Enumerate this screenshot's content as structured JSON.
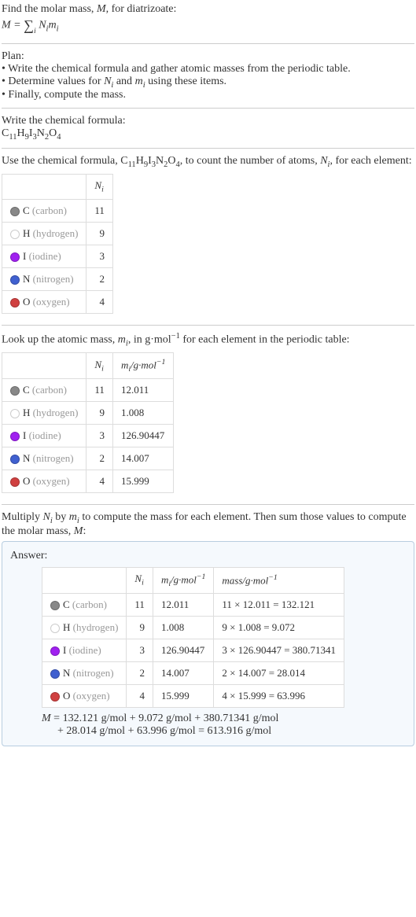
{
  "intro": {
    "line1_a": "Find the molar mass, ",
    "line1_b": ", for diatrizoate:",
    "formula_lhs": "M",
    "formula_eq": " = ",
    "formula_sum": "∑",
    "formula_sum_sub": "i",
    "formula_rhs_a": "N",
    "formula_rhs_b": "m",
    "formula_sub_i": "i"
  },
  "plan": {
    "heading": "Plan:",
    "bullets": [
      "• Write the chemical formula and gather atomic masses from the periodic table.",
      "• Determine values for ",
      " and ",
      " using these items.",
      "• Finally, compute the mass."
    ],
    "Ni": "N",
    "mi": "m",
    "sub_i": "i"
  },
  "chemformula": {
    "heading": "Write the chemical formula:",
    "parts": [
      "C",
      "11",
      "H",
      "9",
      "I",
      "3",
      "N",
      "2",
      "O",
      "4"
    ]
  },
  "count_section": {
    "text_a": "Use the chemical formula, ",
    "text_b": ", to count the number of atoms, ",
    "text_c": ", for each element:",
    "Ni": "N",
    "sub_i": "i"
  },
  "elements": [
    {
      "sym": "C",
      "name": "(carbon)",
      "n": "11",
      "m": "12.011",
      "calc": "11 × 12.011 = 132.121",
      "color": "#888"
    },
    {
      "sym": "H",
      "name": "(hydrogen)",
      "n": "9",
      "m": "1.008",
      "calc": "9 × 1.008 = 9.072",
      "color": "#fff"
    },
    {
      "sym": "I",
      "name": "(iodine)",
      "n": "3",
      "m": "126.90447",
      "calc": "3 × 126.90447 = 380.71341",
      "color": "#a020f0"
    },
    {
      "sym": "N",
      "name": "(nitrogen)",
      "n": "2",
      "m": "14.007",
      "calc": "2 × 14.007 = 28.014",
      "color": "#4060d0"
    },
    {
      "sym": "O",
      "name": "(oxygen)",
      "n": "4",
      "m": "15.999",
      "calc": "4 × 15.999 = 63.996",
      "color": "#d04040"
    }
  ],
  "headers": {
    "Ni": "N",
    "sub_i": "i",
    "mi": "m",
    "mi_unit": "/g·mol",
    "neg1": "−1",
    "mass_unit": "mass/g·mol"
  },
  "lookup": {
    "text_a": "Look up the atomic mass, ",
    "text_b": ", in g·mol",
    "text_c": " for each element in the periodic table:"
  },
  "multiply": {
    "text_a": "Multiply ",
    "text_b": " by ",
    "text_c": " to compute the mass for each element. Then sum those values to compute the molar mass, ",
    "text_d": ":",
    "M": "M"
  },
  "answer": {
    "label": "Answer:",
    "final_a": "M",
    "final_eq": " = 132.121 g/mol + 9.072 g/mol + 380.71341 g/mol",
    "final_line2": "+ 28.014 g/mol + 63.996 g/mol = 613.916 g/mol"
  }
}
